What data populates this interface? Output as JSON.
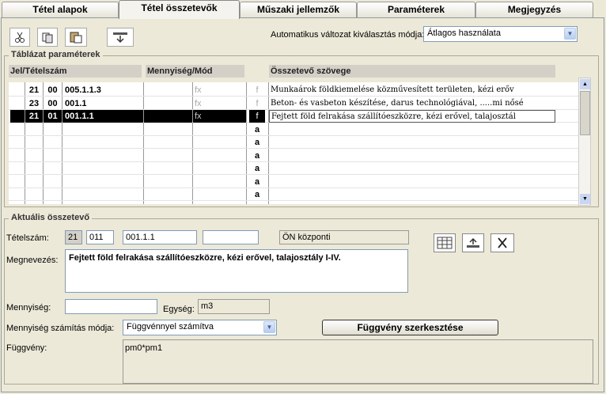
{
  "tabs": [
    {
      "label": "Tétel alapok"
    },
    {
      "label": "Tétel összetevők"
    },
    {
      "label": "Műszaki jellemzők"
    },
    {
      "label": "Paraméterek"
    },
    {
      "label": "Megjegyzés"
    }
  ],
  "toolbar": {
    "auto_label": "Automatikus változat kiválasztás módja:",
    "auto_value": "Átlagos használata"
  },
  "table": {
    "group_title": "Táblázat paraméterek",
    "headers": {
      "jel": "Jel/Tételszám",
      "menny": "Mennyiség/Mód",
      "szoveg": "Összetevő szövege"
    },
    "rows": [
      {
        "a": "21",
        "b": "00",
        "c": "005.1.1.3",
        "fx": "fx",
        "mode": "f",
        "text": "Munkaárok földkiemelése közművesített területen, kézi erőv"
      },
      {
        "a": "23",
        "b": "00",
        "c": "001.1",
        "fx": "fx",
        "mode": "f",
        "text": "Beton- és vasbeton készítése, darus technológiával, .....mi nősé"
      },
      {
        "a": "21",
        "b": "01",
        "c": "001.1.1",
        "fx": "fx",
        "mode": "f",
        "text": "Fejtett föld felrakása szállítóeszközre, kézi erővel, talajosztál"
      },
      {
        "mode": "a"
      },
      {
        "mode": "a"
      },
      {
        "mode": "a"
      },
      {
        "mode": "a"
      },
      {
        "mode": "a"
      },
      {
        "mode": "a"
      },
      {
        "mode": "a"
      },
      {
        "mode": "a"
      }
    ]
  },
  "current": {
    "group_title": "Aktuális összetevő",
    "tetelszam_label": "Tételszám:",
    "t1": "21",
    "t2": "011",
    "t3": "001.1.1",
    "t4": "",
    "t5": "ÖN központi",
    "megnevezes_label": "Megnevezés:",
    "megnevezes": "Fejtett föld felrakása szállítóeszközre, kézi erővel, talajosztály I-IV.",
    "mennyiseg_label": "Mennyiség:",
    "mennyiseg": "",
    "egyseg_label": "Egység:",
    "egyseg": "m3",
    "mod_label": "Mennyiség számítás módja:",
    "mod_value": "Függvénnyel számítva",
    "fv_button": "Függvény szerkesztése",
    "fv_label": "Függvény:",
    "fv_value": "pm0*pm1"
  }
}
